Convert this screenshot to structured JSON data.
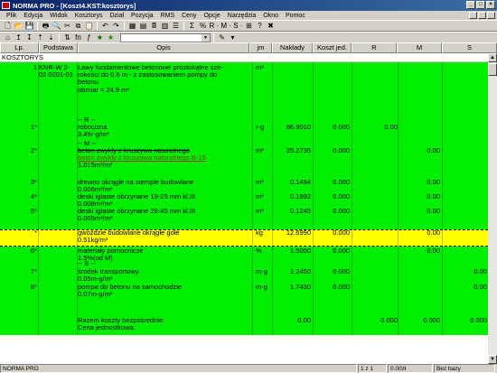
{
  "window": {
    "title": "NORMA PRO - [Koszt4.KST:kosztorys]"
  },
  "menu": [
    "Plik",
    "Edycja",
    "Widok",
    "Kosztorys",
    "Dział",
    "Pozycja",
    "RMS",
    "Ceny",
    "Opcje",
    "Narzędzia",
    "Okno",
    "Pomoc"
  ],
  "toolbar": {
    "rms_label": "R · M · S ·",
    "font_label": "fn"
  },
  "columns": [
    "Lp.",
    "Podstawa",
    "Opis",
    "jm",
    "Nakłady",
    "Koszt jed.",
    "R",
    "M",
    "S"
  ],
  "section": "KOSZTORYS",
  "rows": [
    {
      "lp": "1",
      "podstawa": "KNR-W 2-02 0201-01",
      "opis": [
        "Ławy fundamentowe betonowe prostokątne sze-",
        "rokości do 0.6 m - z zastosowaniem pompy do",
        "betonu",
        "obmiar = 24.9 m³"
      ],
      "jm": "m³",
      "naklady": "",
      "koszt": "",
      "R": "",
      "M": "",
      "S": ""
    },
    {
      "lp": "",
      "podstawa": "",
      "opis": [
        "-- R --"
      ],
      "jm": "",
      "naklady": "",
      "koszt": "",
      "R": "",
      "M": "",
      "S": ""
    },
    {
      "lp": "1*",
      "podstawa": "",
      "opis": [
        "robocizna",
        "3.49r-g/m³"
      ],
      "jm": "r-g",
      "naklady": "86.9010",
      "koszt": "0.000",
      "R": "0.00",
      "M": "",
      "S": ""
    },
    {
      "lp": "",
      "podstawa": "",
      "opis": [
        "-- M --"
      ],
      "jm": "",
      "naklady": "",
      "koszt": "",
      "R": "",
      "M": "",
      "S": ""
    },
    {
      "lp": "2*",
      "podstawa": "",
      "opis": [
        "beton zwykły z kruszywa naturalnego",
        "beton zwykły z kruszywa naturalnego B-15",
        "1.015m³/m³"
      ],
      "jm": "m³",
      "naklady": "25.2735",
      "koszt": "0.000",
      "R": "",
      "M": "0.00",
      "S": ""
    },
    {
      "lp": "3*",
      "podstawa": "",
      "opis": [
        "drewno okrągłe na stemple budowlane",
        "0.006m³/m³"
      ],
      "jm": "m³",
      "naklady": "0.1494",
      "koszt": "0.000",
      "R": "",
      "M": "0.00",
      "S": ""
    },
    {
      "lp": "4*",
      "podstawa": "",
      "opis": [
        "deski iglaste obrzynane 19-25 mm kl.III",
        "0.008m³/m³"
      ],
      "jm": "m³",
      "naklady": "0.1992",
      "koszt": "0.000",
      "R": "",
      "M": "0.00",
      "S": ""
    },
    {
      "lp": "5*",
      "podstawa": "",
      "opis": [
        "deski iglaste obrzynane 28-45 mm kl.III",
        "0.005m³/m³"
      ],
      "jm": "m³",
      "naklady": "0.1245",
      "koszt": "0.000",
      "R": "",
      "M": "0.00",
      "S": ""
    },
    {
      "lp": "*",
      "podstawa": "",
      "opis": [
        "gwoździe budowlane okrągłe gołe",
        "0.51kg/m³"
      ],
      "jm": "kg",
      "naklady": "12.6990",
      "koszt": "0.000",
      "R": "",
      "M": "0.00",
      "S": ""
    },
    {
      "lp": "6*",
      "podstawa": "",
      "opis": [
        "materiały pomocnicze",
        "1.5%(od M)"
      ],
      "jm": "%",
      "naklady": "1.5000",
      "koszt": "0.000",
      "R": "",
      "M": "0.00",
      "S": ""
    },
    {
      "lp": "",
      "podstawa": "",
      "opis": [
        "-- S --"
      ],
      "jm": "",
      "naklady": "",
      "koszt": "",
      "R": "",
      "M": "",
      "S": ""
    },
    {
      "lp": "7*",
      "podstawa": "",
      "opis": [
        "środek transportowy",
        "0.05m-g/m³"
      ],
      "jm": "m-g",
      "naklady": "1.2450",
      "koszt": "0.000",
      "R": "",
      "M": "",
      "S": "0.00"
    },
    {
      "lp": "8*",
      "podstawa": "",
      "opis": [
        "pompa do betonu na samochodzie",
        "0.07m-g/m³"
      ],
      "jm": "m-g",
      "naklady": "1.7430",
      "koszt": "0.000",
      "R": "",
      "M": "",
      "S": "0.00"
    },
    {
      "lp": "",
      "podstawa": "",
      "opis": [
        "Razem koszty bezpośrednie:",
        "Cena jednostkowa:"
      ],
      "jm": "",
      "naklady": "0.00",
      "koszt": "",
      "R": "0.000",
      "M": "0.000",
      "S": "0.000"
    }
  ],
  "status": {
    "app": "NORMA PRO",
    "scale": "1 z 1",
    "value": "0.00zł",
    "base": "Bez bazy"
  }
}
